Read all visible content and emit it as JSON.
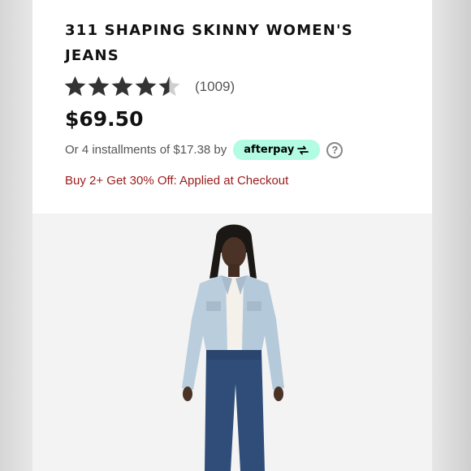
{
  "product": {
    "title": "311 SHAPING SKINNY WOMEN'S JEANS",
    "rating": 4.5,
    "rating_max": 5,
    "review_count": "(1009)",
    "price": "$69.50",
    "installments_text": "Or 4 installments of $17.38 by",
    "afterpay_label": "afterpay",
    "help_symbol": "?",
    "promo": "Buy 2+ Get 30% Off: Applied at Checkout"
  },
  "colors": {
    "star": "#333333",
    "star_empty": "#cfcfcf",
    "promo": "#9b1b1b",
    "afterpay_bg": "#b2fce4"
  },
  "icons": [
    "star-icon",
    "afterpay-arrows-icon",
    "help-icon"
  ]
}
